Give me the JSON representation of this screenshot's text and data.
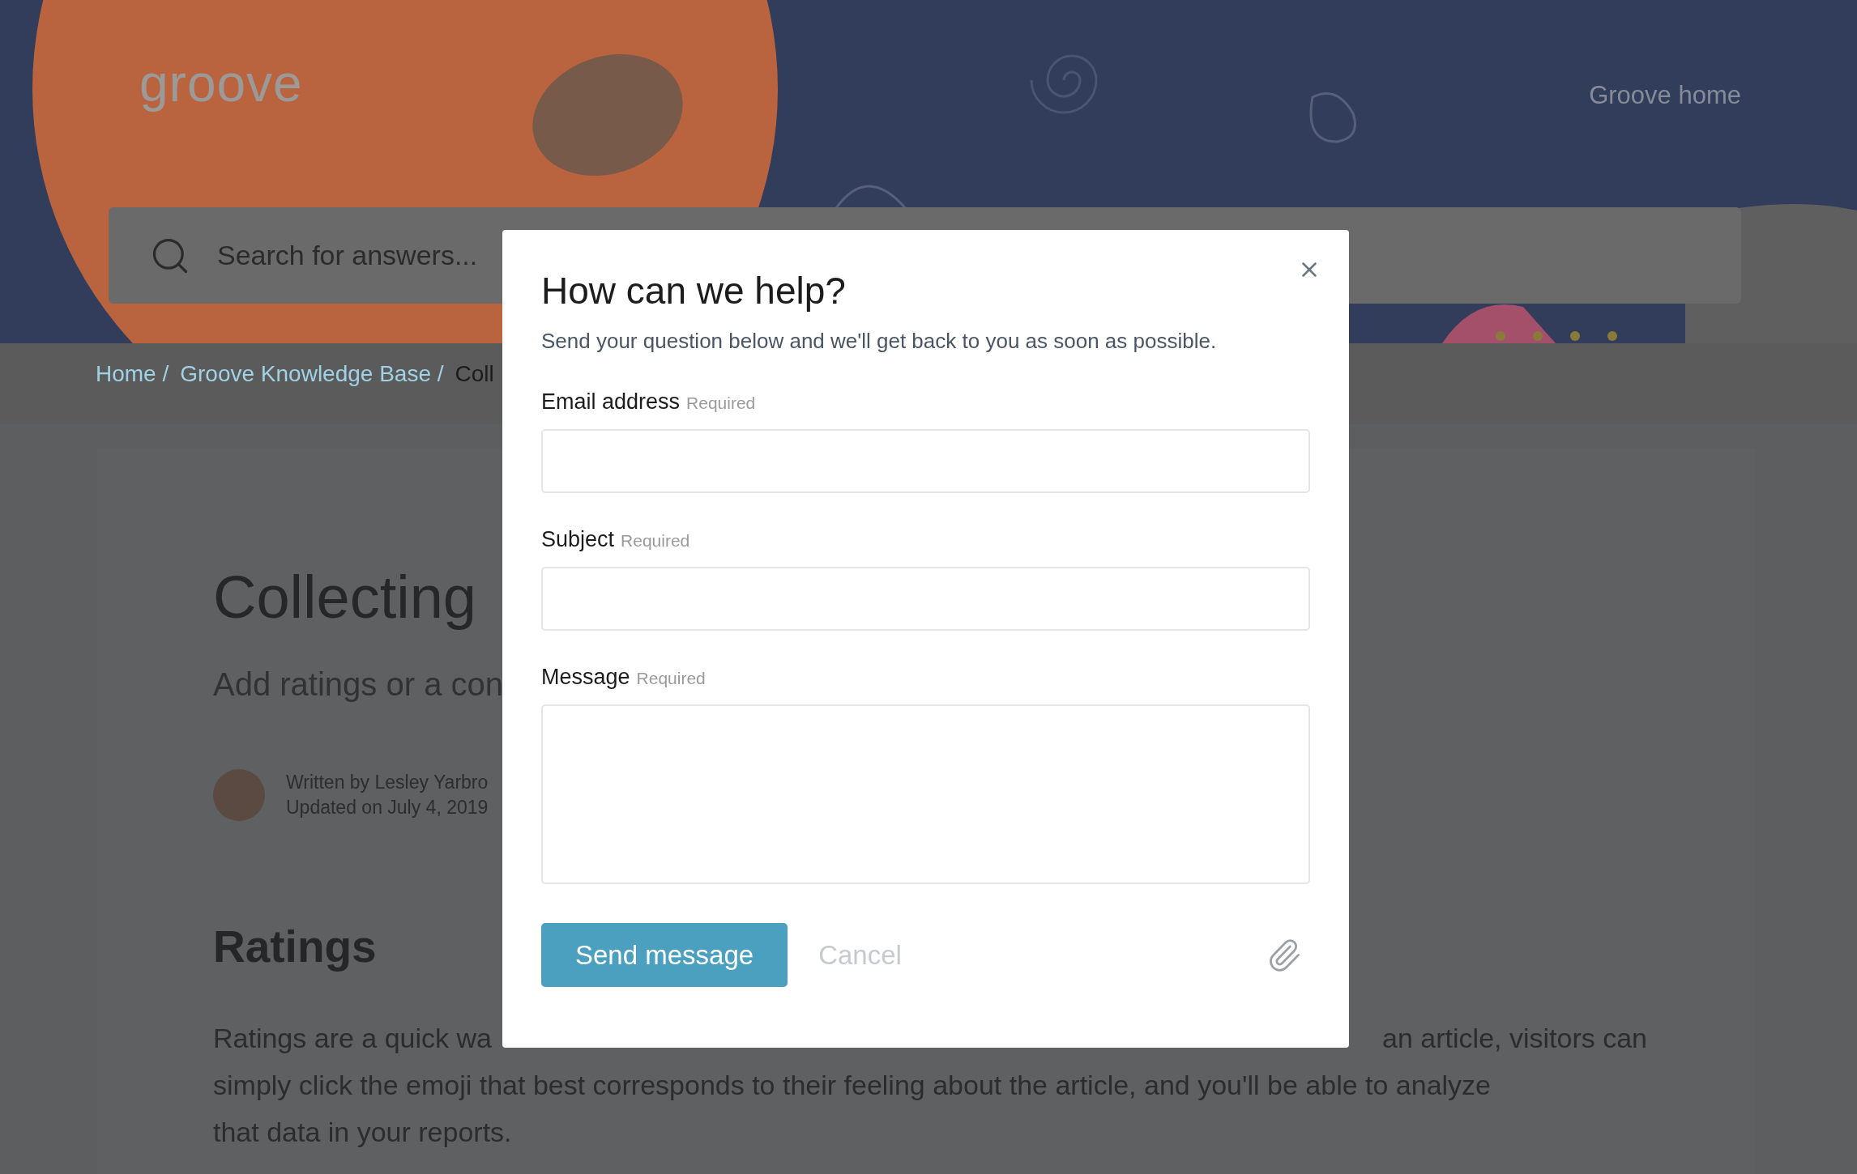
{
  "header": {
    "logo": "groove",
    "nav_link": "Groove home",
    "search": {
      "placeholder": "Search for answers..."
    }
  },
  "breadcrumb": [
    {
      "label": "Home /",
      "kind": "link"
    },
    {
      "label": "Groove Knowledge Base /",
      "kind": "link"
    },
    {
      "label": "Coll",
      "kind": "current"
    }
  ],
  "article": {
    "title": "Collecting",
    "subtitle": "Add ratings or a con",
    "author": {
      "written_by": "Written by Lesley Yarbro",
      "updated": "Updated on July 4, 2019"
    },
    "section_heading": "Ratings",
    "paragraph_lines": [
      [
        "Ratings are a quick wa",
        "an article, visitors can"
      ],
      [
        "simply click the emoji that best corresponds to their feeling about the article, and you'll be able to analyze"
      ],
      [
        "that data in your reports."
      ]
    ]
  },
  "modal": {
    "title": "How can we help?",
    "subtitle": "Send your question below and we'll get back to you as soon as possible.",
    "fields": [
      {
        "label": "Email address",
        "hint": "Required",
        "kind": "input"
      },
      {
        "label": "Subject",
        "hint": "Required",
        "kind": "input"
      },
      {
        "label": "Message",
        "hint": "Required",
        "kind": "textarea"
      }
    ],
    "buttons": [
      {
        "label": "Send message",
        "kind": "primary"
      },
      {
        "label": "Cancel",
        "kind": "link"
      }
    ]
  }
}
